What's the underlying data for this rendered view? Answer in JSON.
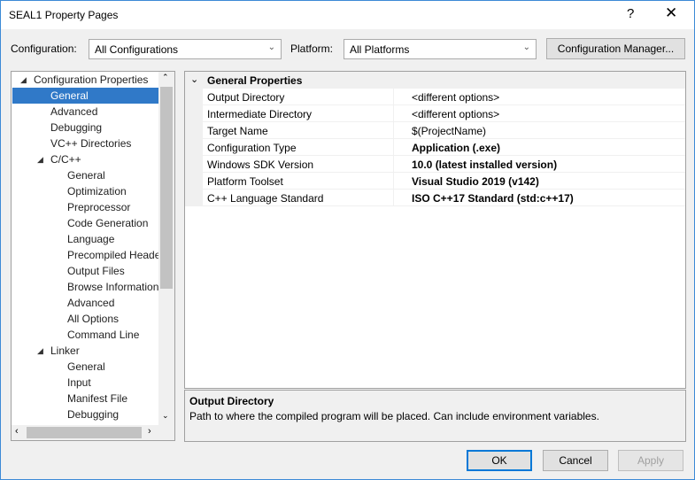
{
  "window": {
    "title": "SEAL1 Property Pages",
    "help": "?",
    "close": "✕"
  },
  "config": {
    "label": "Configuration:",
    "value": "All Configurations",
    "platform_label": "Platform:",
    "platform_value": "All Platforms",
    "manager_button": "Configuration Manager..."
  },
  "tree": [
    {
      "label": "Configuration Properties",
      "level": 0,
      "expanded": true
    },
    {
      "label": "General",
      "level": 1,
      "selected": true
    },
    {
      "label": "Advanced",
      "level": 1
    },
    {
      "label": "Debugging",
      "level": 1
    },
    {
      "label": "VC++ Directories",
      "level": 1
    },
    {
      "label": "C/C++",
      "level": 1,
      "expanded": true
    },
    {
      "label": "General",
      "level": 2
    },
    {
      "label": "Optimization",
      "level": 2
    },
    {
      "label": "Preprocessor",
      "level": 2
    },
    {
      "label": "Code Generation",
      "level": 2
    },
    {
      "label": "Language",
      "level": 2
    },
    {
      "label": "Precompiled Headers",
      "level": 2
    },
    {
      "label": "Output Files",
      "level": 2
    },
    {
      "label": "Browse Information",
      "level": 2
    },
    {
      "label": "Advanced",
      "level": 2
    },
    {
      "label": "All Options",
      "level": 2
    },
    {
      "label": "Command Line",
      "level": 2
    },
    {
      "label": "Linker",
      "level": 1,
      "expanded": true
    },
    {
      "label": "General",
      "level": 2
    },
    {
      "label": "Input",
      "level": 2
    },
    {
      "label": "Manifest File",
      "level": 2
    },
    {
      "label": "Debugging",
      "level": 2
    }
  ],
  "grid": {
    "section": "General Properties",
    "rows": [
      {
        "name": "Output Directory",
        "value": "<different options>",
        "bold": false
      },
      {
        "name": "Intermediate Directory",
        "value": "<different options>",
        "bold": false
      },
      {
        "name": "Target Name",
        "value": "$(ProjectName)",
        "bold": false
      },
      {
        "name": "Configuration Type",
        "value": "Application (.exe)",
        "bold": true
      },
      {
        "name": "Windows SDK Version",
        "value": "10.0 (latest installed version)",
        "bold": true
      },
      {
        "name": "Platform Toolset",
        "value": "Visual Studio 2019 (v142)",
        "bold": true
      },
      {
        "name": "C++ Language Standard",
        "value": "ISO C++17 Standard (std:c++17)",
        "bold": true
      }
    ]
  },
  "description": {
    "title": "Output Directory",
    "text": "Path to where the compiled program will be placed. Can include environment variables."
  },
  "buttons": {
    "ok": "OK",
    "cancel": "Cancel",
    "apply": "Apply"
  }
}
